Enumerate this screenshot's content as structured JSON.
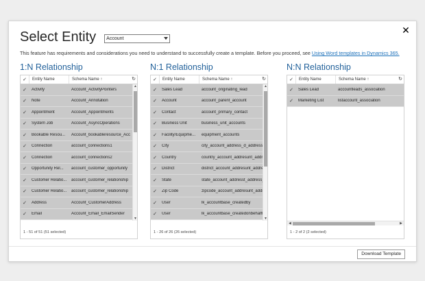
{
  "dialog": {
    "title": "Select Entity",
    "entity_selected": "Account",
    "notice_text": "This feature has requirements and considerations you need to understand to successfully create a template. Before you proceed, see ",
    "notice_link": "Using Word templates in Dynamics 365.",
    "close_glyph": "✕",
    "download_label": "Download Template"
  },
  "icons": {
    "check": "✓",
    "refresh": "↻",
    "sort": "↑"
  },
  "groups": [
    {
      "title": "1:N Relationship",
      "col1": "Entity Name",
      "col2": "Schema Name",
      "count": "1 - 51 of 51 (51 selected)",
      "rows": [
        {
          "entity": "Activity",
          "schema": "Account_ActivityPointers"
        },
        {
          "entity": "Note",
          "schema": "Account_Annotation"
        },
        {
          "entity": "Appointment",
          "schema": "Account_Appointments"
        },
        {
          "entity": "System Job",
          "schema": "Account_AsyncOperations"
        },
        {
          "entity": "Bookable Resou...",
          "schema": "Account_bookableresource_Acc"
        },
        {
          "entity": "Connection",
          "schema": "account_connections1"
        },
        {
          "entity": "Connection",
          "schema": "account_connections2"
        },
        {
          "entity": "Opportunity Rel...",
          "schema": "account_customer_opportunity"
        },
        {
          "entity": "Customer Relatio...",
          "schema": "account_customer_relationship"
        },
        {
          "entity": "Customer Relatio...",
          "schema": "account_customer_relationship"
        },
        {
          "entity": "Address",
          "schema": "Account_CustomerAddress"
        },
        {
          "entity": "Email",
          "schema": "Account_Email_EmailSender"
        }
      ]
    },
    {
      "title": "N:1 Relationship",
      "col1": "Entity Name",
      "col2": "Schema Name",
      "count": "1 - 26 of 26 (26 selected)",
      "rows": [
        {
          "entity": "Sales Lead",
          "schema": "account_originating_lead"
        },
        {
          "entity": "Account",
          "schema": "account_parent_account"
        },
        {
          "entity": "Contact",
          "schema": "account_primary_contact"
        },
        {
          "entity": "Business Unit",
          "schema": "business_unit_accounts"
        },
        {
          "entity": "Facility/Equipme...",
          "schema": "equipment_accounts"
        },
        {
          "entity": "City",
          "schema": "city_account_address_d_address_ci"
        },
        {
          "entity": "Country",
          "schema": "country_account_addresunt_address"
        },
        {
          "entity": "District",
          "schema": "district_account_addresunt_address"
        },
        {
          "entity": "State",
          "schema": "state_account_addresst_address_"
        },
        {
          "entity": "Zip Code",
          "schema": "zipcode_account_addresunt_address"
        },
        {
          "entity": "User",
          "schema": "lk_accountbase_createdby"
        },
        {
          "entity": "User",
          "schema": "lk_accountbase_createdonbehalfby"
        }
      ]
    },
    {
      "title": "N:N Relationship",
      "col1": "Entity Name",
      "col2": "Schema Name",
      "count": "1 - 2 of 2 (2 selected)",
      "rows": [
        {
          "entity": "Sales Lead",
          "schema": "accountleads_association"
        },
        {
          "entity": "Marketing List",
          "schema": "listaccount_association"
        }
      ]
    }
  ]
}
